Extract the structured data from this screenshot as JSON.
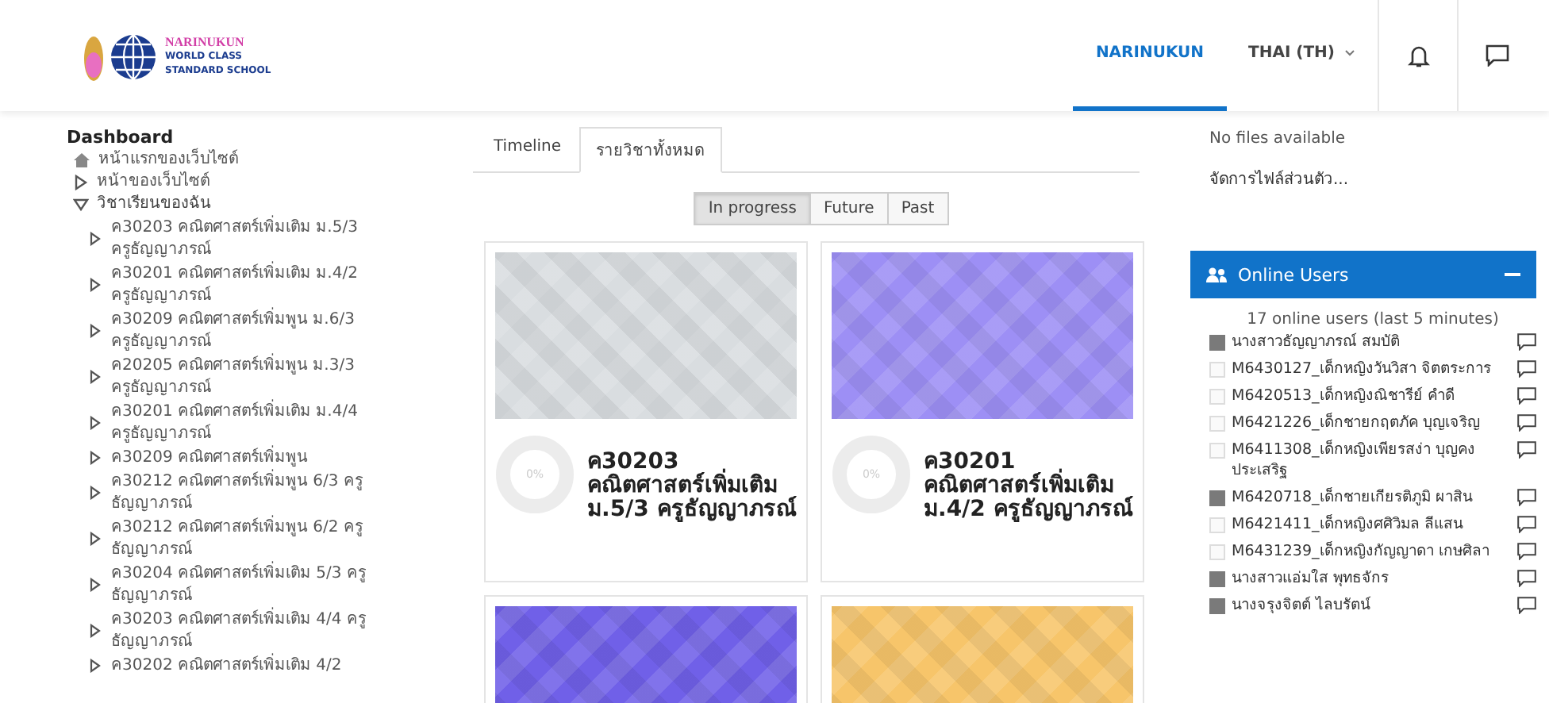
{
  "header": {
    "logo_line1": "NARINUKUN",
    "logo_line2": "WORLD CLASS",
    "logo_line3": "STANDARD SCHOOL",
    "nav": [
      {
        "label": "NARINUKUN",
        "selected": true
      },
      {
        "label": "THAI (TH)",
        "selected": false
      }
    ]
  },
  "sidebar": {
    "title": "Dashboard",
    "home": "หน้าแรกของเว็บไซต์",
    "items": [
      {
        "label": "หน้าของเว็บไซต์",
        "expanded": false
      },
      {
        "label": "วิชาเรียนของฉัน",
        "expanded": true,
        "children": [
          {
            "label": "ค30203 คณิตศาสตร์เพิ่มเติม ม.5/3 ครูธัญญาภรณ์"
          },
          {
            "label": "ค30201 คณิตศาสตร์เพิ่มเติม ม.4/2 ครูธัญญาภรณ์"
          },
          {
            "label": "ค30209 คณิตศาสตร์เพิ่มพูน ม.6/3 ครูธัญญาภรณ์"
          },
          {
            "label": "ค20205 คณิตศาสตร์เพิ่มพูน ม.3/3 ครูธัญญาภรณ์"
          },
          {
            "label": "ค30201 คณิตศาสตร์เพิ่มเติม ม.4/4 ครูธัญญาภรณ์"
          },
          {
            "label": "ค30209 คณิตศาสตร์เพิ่มพูน"
          },
          {
            "label": "ค30212 คณิตศาสตร์เพิ่มพูน 6/3 ครูธัญญาภรณ์"
          },
          {
            "label": "ค30212 คณิตศาสตร์เพิ่มพูน 6/2 ครูธัญญาภรณ์"
          },
          {
            "label": "ค30204 คณิตศาสตร์เพิ่มเติม 5/3 ครูธัญญาภรณ์"
          },
          {
            "label": "ค30203 คณิตศาสตร์เพิ่มเติม 4/4 ครูธัญญาภรณ์"
          },
          {
            "label": "ค30202 คณิตศาสตร์เพิ่มเติม 4/2"
          }
        ]
      }
    ]
  },
  "tabs": [
    {
      "label": "Timeline",
      "selected": false
    },
    {
      "label": "รายวิชาทั้งหมด",
      "selected": true
    }
  ],
  "filters": [
    {
      "label": "In progress",
      "selected": true
    },
    {
      "label": "Future",
      "selected": false
    },
    {
      "label": "Past",
      "selected": false
    }
  ],
  "courses": [
    {
      "color": "#d9dde0",
      "progress": "0%",
      "title": "ค30203 คณิตศาสตร์เพิ่มเติม ม.5/3 ครูธัญญาภรณ์"
    },
    {
      "color": "#9d8ff5",
      "progress": "0%",
      "title": "ค30201 คณิตศาสตร์เพิ่มเติม ม.4/2 ครูธัญญาภรณ์"
    },
    {
      "color": "#7060e8"
    },
    {
      "color": "#f7c56a"
    }
  ],
  "files": {
    "empty": "No files available",
    "manage": "จัดการไฟล์ส่วนตัว..."
  },
  "online_users": {
    "title": "Online Users",
    "summary": "17 online users (last 5 minutes)",
    "users": [
      {
        "name": "นางสาวธัญญาภรณ์ สมบัติ",
        "kind": "photo"
      },
      {
        "name": "M6430127_เด็กหญิงวันวิสา จิตตระการ",
        "kind": "blank"
      },
      {
        "name": "M6420513_เด็กหญิงณิชารีย์ คำดี",
        "kind": "blank"
      },
      {
        "name": "M6421226_เด็กชายกฤตภัค บุญเจริญ",
        "kind": "blank"
      },
      {
        "name": "M6411308_เด็กหญิงเพียรสง่า บุญคงประเสริฐ",
        "kind": "blank"
      },
      {
        "name": "M6420718_เด็กชายเกียรติภูมิ ผาสิน",
        "kind": "photo"
      },
      {
        "name": "M6421411_เด็กหญิงศศิวิมล ลีแสน",
        "kind": "blank"
      },
      {
        "name": "M6431239_เด็กหญิงกัญญาดา เกษศิลา",
        "kind": "blank"
      },
      {
        "name": "นางสาวแอ่มใส พุทธจักร",
        "kind": "photo"
      },
      {
        "name": "นางจรุงจิตต์ ไลบรัตน์",
        "kind": "photo"
      }
    ]
  }
}
